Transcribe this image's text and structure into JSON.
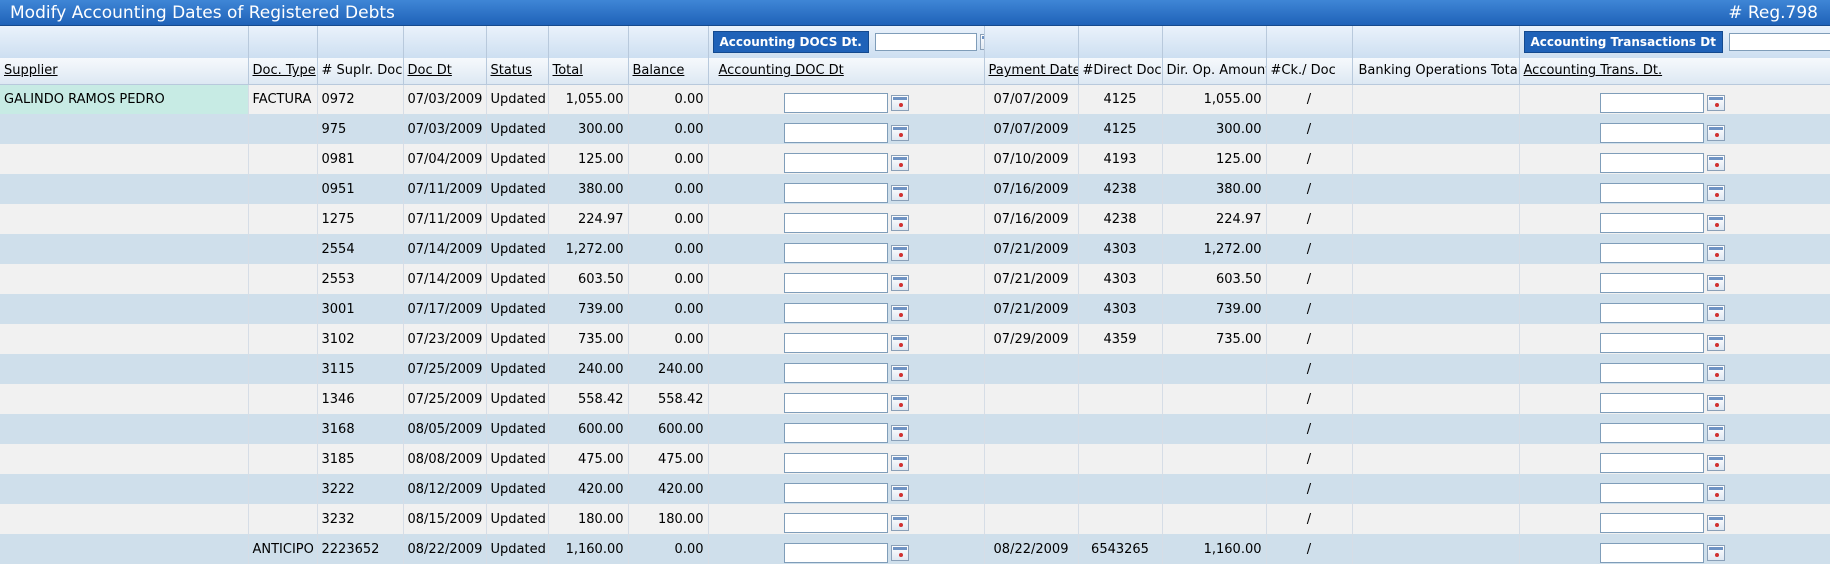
{
  "title": "Modify Accounting Dates of Registered Debts",
  "reg": "# Reg.798",
  "filters": {
    "docs_label": "Accounting DOCS Dt.",
    "docs_value": "",
    "trans_label": "Accounting Transactions Dt",
    "trans_value": ""
  },
  "headers": {
    "supplier": "Supplier",
    "doc_type": "Doc. Type",
    "suplr_doc": "# Suplr. Doc.",
    "doc_dt": "Doc Dt",
    "status": "Status",
    "total": "Total",
    "balance": "Balance",
    "acc_doc_dt": "Accounting DOC Dt",
    "payment_date": "Payment Date",
    "direct_doc": "#Direct Doc",
    "dir_op_amount": "Dir. Op. Amount",
    "ck_doc": "#Ck./ Doc",
    "banking_total": "Banking Operations Total",
    "acc_trans_dt": "Accounting Trans. Dt."
  },
  "rows": [
    {
      "supplier": "GALINDO RAMOS PEDRO",
      "doc_type": "FACTURA",
      "suplr_doc": "0972",
      "doc_dt": "07/03/2009",
      "status": "Updated",
      "total": "1,055.00",
      "balance": "0.00",
      "payment_date": "07/07/2009",
      "direct_doc": "4125",
      "dir_op_amount": "1,055.00",
      "ck_doc": "/",
      "banking_total": ""
    },
    {
      "supplier": "",
      "doc_type": "",
      "suplr_doc": "975",
      "doc_dt": "07/03/2009",
      "status": "Updated",
      "total": "300.00",
      "balance": "0.00",
      "payment_date": "07/07/2009",
      "direct_doc": "4125",
      "dir_op_amount": "300.00",
      "ck_doc": "/",
      "banking_total": ""
    },
    {
      "supplier": "",
      "doc_type": "",
      "suplr_doc": "0981",
      "doc_dt": "07/04/2009",
      "status": "Updated",
      "total": "125.00",
      "balance": "0.00",
      "payment_date": "07/10/2009",
      "direct_doc": "4193",
      "dir_op_amount": "125.00",
      "ck_doc": "/",
      "banking_total": ""
    },
    {
      "supplier": "",
      "doc_type": "",
      "suplr_doc": "0951",
      "doc_dt": "07/11/2009",
      "status": "Updated",
      "total": "380.00",
      "balance": "0.00",
      "payment_date": "07/16/2009",
      "direct_doc": "4238",
      "dir_op_amount": "380.00",
      "ck_doc": "/",
      "banking_total": ""
    },
    {
      "supplier": "",
      "doc_type": "",
      "suplr_doc": "1275",
      "doc_dt": "07/11/2009",
      "status": "Updated",
      "total": "224.97",
      "balance": "0.00",
      "payment_date": "07/16/2009",
      "direct_doc": "4238",
      "dir_op_amount": "224.97",
      "ck_doc": "/",
      "banking_total": ""
    },
    {
      "supplier": "",
      "doc_type": "",
      "suplr_doc": "2554",
      "doc_dt": "07/14/2009",
      "status": "Updated",
      "total": "1,272.00",
      "balance": "0.00",
      "payment_date": "07/21/2009",
      "direct_doc": "4303",
      "dir_op_amount": "1,272.00",
      "ck_doc": "/",
      "banking_total": ""
    },
    {
      "supplier": "",
      "doc_type": "",
      "suplr_doc": "2553",
      "doc_dt": "07/14/2009",
      "status": "Updated",
      "total": "603.50",
      "balance": "0.00",
      "payment_date": "07/21/2009",
      "direct_doc": "4303",
      "dir_op_amount": "603.50",
      "ck_doc": "/",
      "banking_total": ""
    },
    {
      "supplier": "",
      "doc_type": "",
      "suplr_doc": "3001",
      "doc_dt": "07/17/2009",
      "status": "Updated",
      "total": "739.00",
      "balance": "0.00",
      "payment_date": "07/21/2009",
      "direct_doc": "4303",
      "dir_op_amount": "739.00",
      "ck_doc": "/",
      "banking_total": ""
    },
    {
      "supplier": "",
      "doc_type": "",
      "suplr_doc": "3102",
      "doc_dt": "07/23/2009",
      "status": "Updated",
      "total": "735.00",
      "balance": "0.00",
      "payment_date": "07/29/2009",
      "direct_doc": "4359",
      "dir_op_amount": "735.00",
      "ck_doc": "/",
      "banking_total": ""
    },
    {
      "supplier": "",
      "doc_type": "",
      "suplr_doc": "3115",
      "doc_dt": "07/25/2009",
      "status": "Updated",
      "total": "240.00",
      "balance": "240.00",
      "payment_date": "",
      "direct_doc": "",
      "dir_op_amount": "",
      "ck_doc": "/",
      "banking_total": ""
    },
    {
      "supplier": "",
      "doc_type": "",
      "suplr_doc": "1346",
      "doc_dt": "07/25/2009",
      "status": "Updated",
      "total": "558.42",
      "balance": "558.42",
      "payment_date": "",
      "direct_doc": "",
      "dir_op_amount": "",
      "ck_doc": "/",
      "banking_total": ""
    },
    {
      "supplier": "",
      "doc_type": "",
      "suplr_doc": "3168",
      "doc_dt": "08/05/2009",
      "status": "Updated",
      "total": "600.00",
      "balance": "600.00",
      "payment_date": "",
      "direct_doc": "",
      "dir_op_amount": "",
      "ck_doc": "/",
      "banking_total": ""
    },
    {
      "supplier": "",
      "doc_type": "",
      "suplr_doc": "3185",
      "doc_dt": "08/08/2009",
      "status": "Updated",
      "total": "475.00",
      "balance": "475.00",
      "payment_date": "",
      "direct_doc": "",
      "dir_op_amount": "",
      "ck_doc": "/",
      "banking_total": ""
    },
    {
      "supplier": "",
      "doc_type": "",
      "suplr_doc": "3222",
      "doc_dt": "08/12/2009",
      "status": "Updated",
      "total": "420.00",
      "balance": "420.00",
      "payment_date": "",
      "direct_doc": "",
      "dir_op_amount": "",
      "ck_doc": "/",
      "banking_total": ""
    },
    {
      "supplier": "",
      "doc_type": "",
      "suplr_doc": "3232",
      "doc_dt": "08/15/2009",
      "status": "Updated",
      "total": "180.00",
      "balance": "180.00",
      "payment_date": "",
      "direct_doc": "",
      "dir_op_amount": "",
      "ck_doc": "/",
      "banking_total": ""
    },
    {
      "supplier": "",
      "doc_type": "ANTICIPO",
      "suplr_doc": "2223652",
      "doc_dt": "08/22/2009",
      "status": "Updated",
      "total": "1,160.00",
      "balance": "0.00",
      "payment_date": "08/22/2009",
      "direct_doc": "6543265",
      "dir_op_amount": "1,160.00",
      "ck_doc": "/",
      "banking_total": ""
    }
  ]
}
